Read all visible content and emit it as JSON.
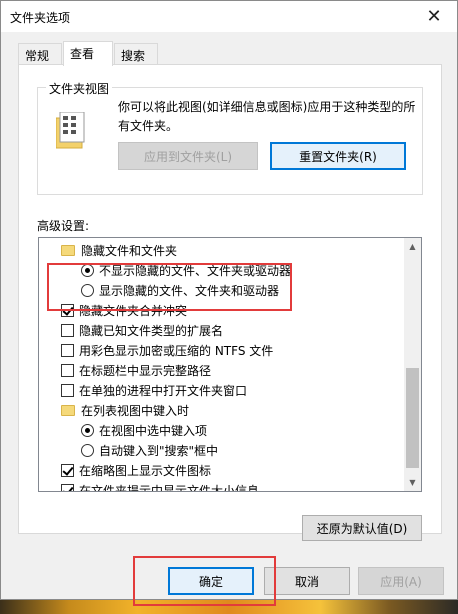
{
  "window": {
    "title": "文件夹选项",
    "close_glyph": "✕"
  },
  "tabs": [
    {
      "label": "常规",
      "active": false
    },
    {
      "label": "查看",
      "active": true
    },
    {
      "label": "搜索",
      "active": false
    }
  ],
  "folder_views": {
    "legend": "文件夹视图",
    "description": "你可以将此视图(如详细信息或图标)应用于这种类型的所有文件夹。",
    "apply_button": "应用到文件夹(L)",
    "reset_button": "重置文件夹(R)"
  },
  "advanced": {
    "label": "高级设置:",
    "items": [
      {
        "type": "folder",
        "indent": 0,
        "label": "隐藏文件和文件夹"
      },
      {
        "type": "radio",
        "indent": 1,
        "checked": true,
        "label": "不显示隐藏的文件、文件夹或驱动器"
      },
      {
        "type": "radio",
        "indent": 1,
        "checked": false,
        "label": "显示隐藏的文件、文件夹和驱动器"
      },
      {
        "type": "checkbox",
        "indent": 0,
        "checked": true,
        "label": "隐藏文件夹合并冲突"
      },
      {
        "type": "checkbox",
        "indent": 0,
        "checked": false,
        "label": "隐藏已知文件类型的扩展名"
      },
      {
        "type": "checkbox",
        "indent": 0,
        "checked": false,
        "label": "用彩色显示加密或压缩的 NTFS 文件"
      },
      {
        "type": "checkbox",
        "indent": 0,
        "checked": false,
        "label": "在标题栏中显示完整路径"
      },
      {
        "type": "checkbox",
        "indent": 0,
        "checked": false,
        "label": "在单独的进程中打开文件夹窗口"
      },
      {
        "type": "folder",
        "indent": 0,
        "label": "在列表视图中键入时"
      },
      {
        "type": "radio",
        "indent": 1,
        "checked": true,
        "label": "在视图中选中键入项"
      },
      {
        "type": "radio",
        "indent": 1,
        "checked": false,
        "label": "自动键入到\"搜索\"框中"
      },
      {
        "type": "checkbox",
        "indent": 0,
        "checked": true,
        "label": "在缩略图上显示文件图标"
      },
      {
        "type": "checkbox",
        "indent": 0,
        "checked": true,
        "label": "在文件夹提示中显示文件大小信息"
      }
    ],
    "restore_button": "还原为默认值(D)"
  },
  "footer": {
    "ok_button": "确定",
    "cancel_button": "取消",
    "apply_button": "应用(A)"
  },
  "colors": {
    "highlight": "#e23b3b",
    "focus": "#0078d7"
  }
}
